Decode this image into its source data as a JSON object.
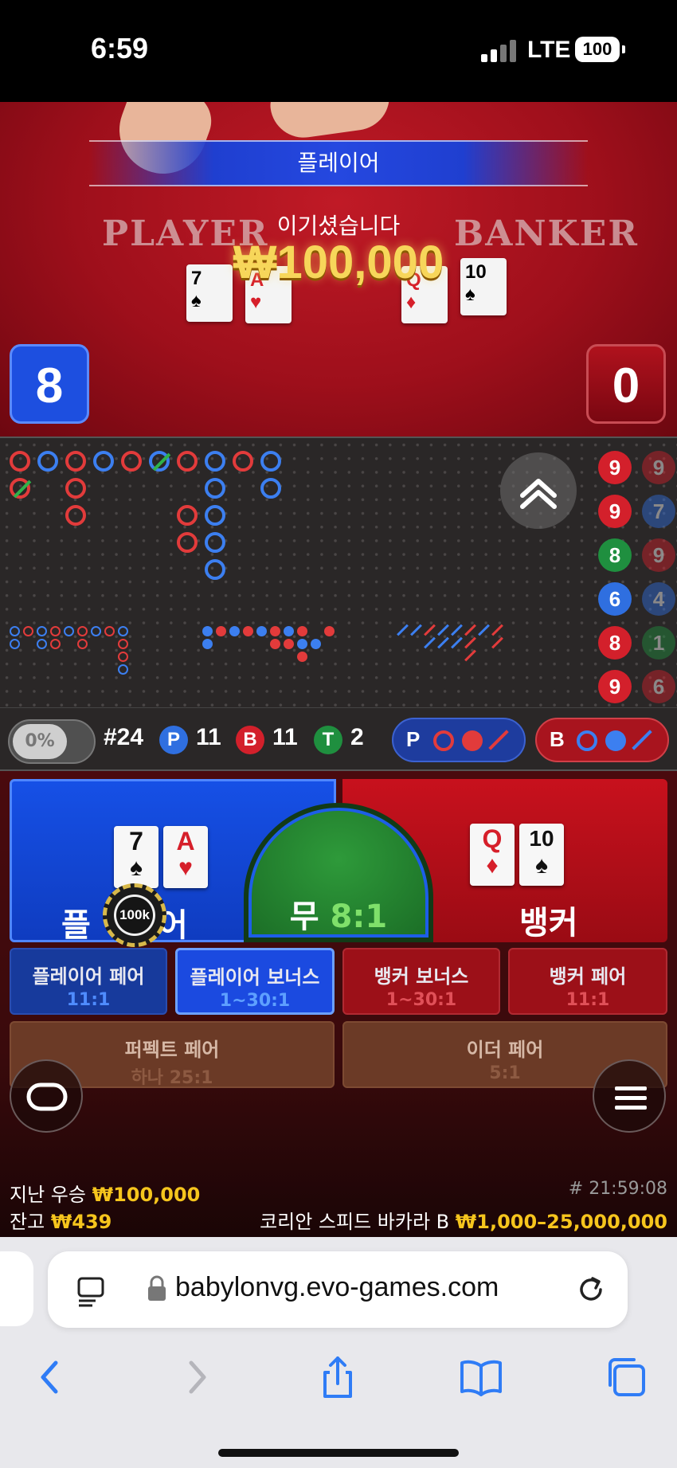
{
  "status_bar": {
    "time": "6:59",
    "network": "LTE",
    "battery": "100"
  },
  "video": {
    "result_label": "플레이어",
    "win_subtitle": "이기셨습니다",
    "win_amount": "₩100,000",
    "table_player": "PLAYER",
    "table_banker": "BANKER",
    "player_score": "8",
    "banker_score": "0",
    "player_cards": [
      {
        "rank": "7",
        "suit": "♠"
      },
      {
        "rank": "A",
        "suit": "♥"
      }
    ],
    "banker_cards": [
      {
        "rank": "Q",
        "suit": "♦"
      },
      {
        "rank": "10",
        "suit": "♠"
      }
    ]
  },
  "bead_road": {
    "col1": [
      "9",
      "9",
      "8",
      "6",
      "8",
      "9"
    ],
    "col2": [
      "9",
      "7",
      "9",
      "4",
      "1",
      "6"
    ]
  },
  "stats": {
    "percent_toggle": "0%",
    "round": "#24",
    "player_letter": "P",
    "player_count": "11",
    "banker_letter": "B",
    "banker_count": "11",
    "tie_letter": "T",
    "tie_count": "2",
    "predict_player": "P",
    "predict_banker": "B"
  },
  "bets": {
    "player_label": "플레이어",
    "player_label_left": "플",
    "player_label_right": "어",
    "tie_label": "무",
    "tie_odds": "8:1",
    "banker_label": "뱅커",
    "chip_value": "100k",
    "side_bets": [
      {
        "label": "플레이어 페어",
        "odds": "11:1"
      },
      {
        "label": "플레이어 보너스",
        "odds": "1~30:1"
      },
      {
        "label": "뱅커 보너스",
        "odds": "1~30:1"
      },
      {
        "label": "뱅커 페어",
        "odds": "11:1"
      }
    ],
    "perfect_pair": {
      "label": "퍼펙트 페어",
      "odds": "하나 25:1"
    },
    "either_pair": {
      "label": "이더 페어",
      "odds": "5:1"
    }
  },
  "footer": {
    "last_win_label": "지난 우승",
    "last_win_amount": "₩100,000",
    "balance_label": "잔고",
    "balance_amount": "₩439",
    "round_id": "# 21:59:08",
    "table_name": "코리안 스피드 바카라 B",
    "limits": "₩1,000–25,000,000"
  },
  "browser": {
    "url": "babylonvg.evo-games.com"
  },
  "colors": {
    "player_blue": "#1650e6",
    "banker_red": "#c8111d",
    "tie_green": "#2e9a3a",
    "gold": "#f6c51d"
  }
}
